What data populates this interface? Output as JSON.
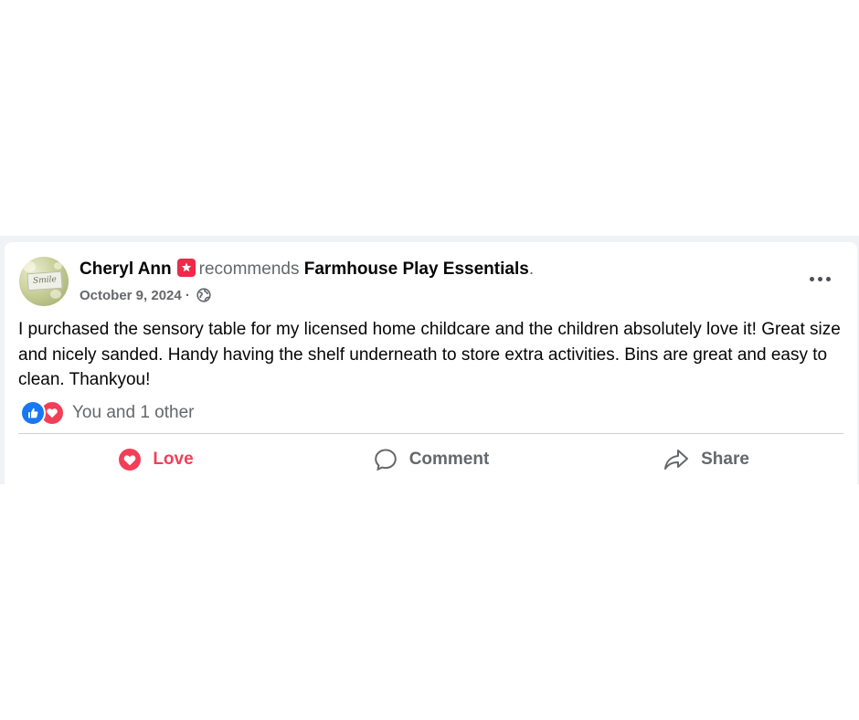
{
  "post": {
    "author": "Cheryl Ann",
    "verb": "recommends",
    "page_name": "Farmhouse Play Essentials",
    "period": ".",
    "date": "October 9, 2024",
    "date_separator": " ·",
    "avatar_text": "Smile",
    "body": "I purchased the sensory table for my licensed home childcare and the children absolutely love it! Great size and nicely sanded. Handy having the shelf underneath to store extra activities. Bins are great and easy to clean. Thankyou!"
  },
  "reactions": {
    "summary": "You and 1 other",
    "types": [
      "like-icon",
      "love-icon"
    ]
  },
  "actions": {
    "love_label": "Love",
    "comment_label": "Comment",
    "share_label": "Share"
  },
  "colors": {
    "love": "#f33e58",
    "like": "#1877f2",
    "badge": "#f02849",
    "secondary_text": "#65676b"
  }
}
